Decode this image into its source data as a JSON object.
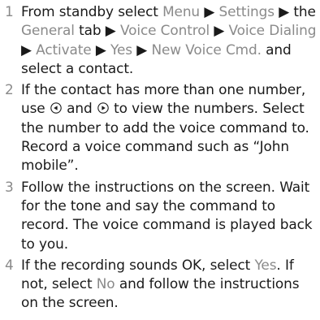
{
  "steps": [
    {
      "number": "1",
      "segments": [
        {
          "text": "From standby select ",
          "highlight": false
        },
        {
          "text": "Menu",
          "highlight": true
        },
        {
          "text": " ▶ ",
          "highlight": false
        },
        {
          "text": "Settings",
          "highlight": true
        },
        {
          "text": " ▶ the ",
          "highlight": false
        },
        {
          "text": "General",
          "highlight": true
        },
        {
          "text": " tab ▶ ",
          "highlight": false
        },
        {
          "text": "Voice Control",
          "highlight": true
        },
        {
          "text": " ▶ ",
          "highlight": false
        },
        {
          "text": "Voice Dialing",
          "highlight": true
        },
        {
          "text": " ▶ ",
          "highlight": false
        },
        {
          "text": "Activate",
          "highlight": true
        },
        {
          "text": " ▶ ",
          "highlight": false
        },
        {
          "text": "Yes",
          "highlight": true
        },
        {
          "text": " ▶ ",
          "highlight": false
        },
        {
          "text": "New Voice Cmd.",
          "highlight": true
        },
        {
          "text": " and select a contact.",
          "highlight": false
        }
      ]
    },
    {
      "number": "2",
      "segments": [
        {
          "text": "If the contact has more than one number, use ",
          "highlight": false
        },
        {
          "icon": "nav-left-key-icon"
        },
        {
          "text": " and ",
          "highlight": false
        },
        {
          "icon": "nav-right-key-icon"
        },
        {
          "text": " to view the numbers. Select the number to add the voice command to. Record a voice command such as “John mobile”.",
          "highlight": false
        }
      ]
    },
    {
      "number": "3",
      "segments": [
        {
          "text": "Follow the instructions on the screen. Wait for the tone and say the command to record. The voice command is played back to you.",
          "highlight": false
        }
      ]
    },
    {
      "number": "4",
      "segments": [
        {
          "text": "If the recording sounds OK, select ",
          "highlight": false
        },
        {
          "text": "Yes",
          "highlight": true
        },
        {
          "text": ". If not, select ",
          "highlight": false
        },
        {
          "text": "No",
          "highlight": true
        },
        {
          "text": " and follow the instructions on the screen.",
          "highlight": false
        }
      ]
    }
  ],
  "colors": {
    "body_text": "#1a1a1a",
    "highlight_text": "#8a8a8a"
  }
}
